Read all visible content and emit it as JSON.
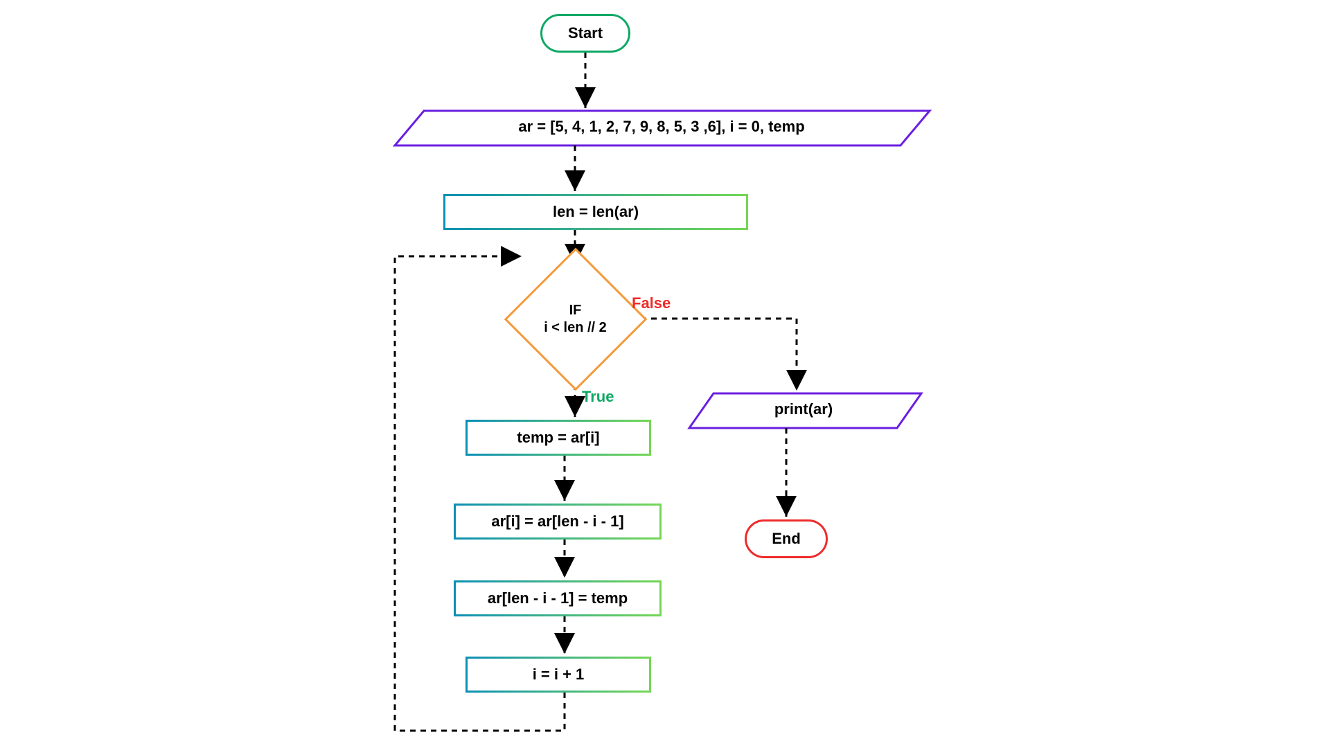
{
  "flow": {
    "start": "Start",
    "init": "ar = [5, 4, 1, 2, 7, 9, 8, 5, 3 ,6], i = 0,  temp",
    "len": "len = len(ar)",
    "decision_line1": "IF",
    "decision_line2": "i < len // 2",
    "true_label": "True",
    "false_label": "False",
    "step_temp": "temp = ar[i]",
    "step_swap1": "ar[i] = ar[len - i - 1]",
    "step_swap2": "ar[len - i - 1] = temp",
    "step_inc": "i = i + 1",
    "print": "print(ar)",
    "end": "End"
  }
}
